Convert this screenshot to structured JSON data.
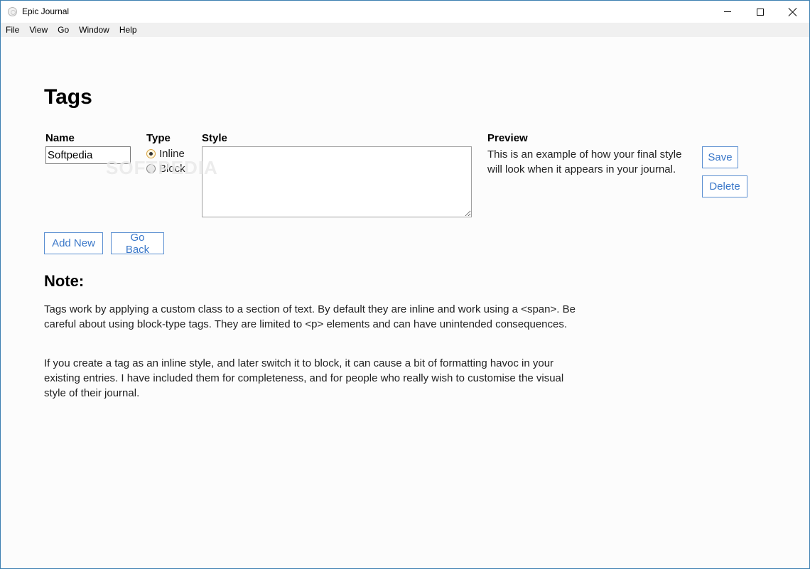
{
  "window": {
    "title": "Epic Journal"
  },
  "menu": [
    "File",
    "View",
    "Go",
    "Window",
    "Help"
  ],
  "page": {
    "heading": "Tags",
    "columns": {
      "name": "Name",
      "type": "Type",
      "style": "Style",
      "preview": "Preview"
    },
    "name_value": "Softpedia",
    "type_options": [
      {
        "label": "Inline",
        "checked": true
      },
      {
        "label": "Block",
        "checked": false
      }
    ],
    "style_value": "",
    "preview_text": "This is an example of how your final style will look when it appears in your journal.",
    "buttons": {
      "save": "Save",
      "delete": "Delete",
      "add_new": "Add New",
      "go_back": "Go Back"
    },
    "note_heading": "Note:",
    "note_paragraphs": [
      "Tags work by applying a custom class to a section of text. By default they are inline and work using a <span>. Be careful about using block-type tags. They are limited to <p> elements and can have unintended consequences.",
      "If you create a tag as an inline style, and later switch it to block, it can cause a bit of formatting havoc in your existing entries. I have included them for completeness, and for people who really wish to customise the visual style of their journal."
    ]
  },
  "watermark": "SOFTPEDIA",
  "colors": {
    "button_border": "#5b8fd1",
    "button_text": "#3b78c9",
    "window_border": "#3c7fb1"
  }
}
